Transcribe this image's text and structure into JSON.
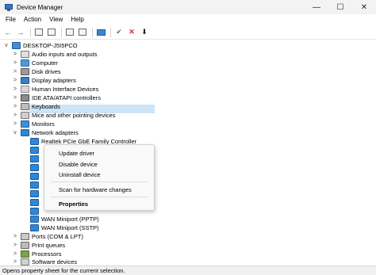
{
  "window": {
    "title": "Device Manager",
    "controls": {
      "minimize": "—",
      "maximize": "☐",
      "close": "✕"
    }
  },
  "menu": [
    "File",
    "Action",
    "View",
    "Help"
  ],
  "toolbar": {
    "back": "←",
    "forward": "→",
    "enable": "✔",
    "remove": "✕",
    "update": "⬇"
  },
  "tree": {
    "root": "DESKTOP-J5I5PCO",
    "categories": [
      "Audio inputs and outputs",
      "Computer",
      "Disk drives",
      "Display adapters",
      "Human Interface Devices",
      "IDE ATA/ATAPI controllers",
      "Keyboards",
      "Mice and other pointing devices",
      "Monitors",
      "Network adapters"
    ],
    "network_children": [
      "Realtek PCIe GbE Family Controller",
      "WAN Miniport (PPTP)",
      "WAN Miniport (SSTP)"
    ],
    "after_categories": [
      "Ports (COM & LPT)",
      "Print queues",
      "Processors",
      "Software devices"
    ],
    "expand_collapsed": ">",
    "expand_open": "v"
  },
  "context_menu": {
    "items": [
      "Update driver",
      "Disable device",
      "Uninstall device",
      "Scan for hardware changes",
      "Properties"
    ]
  },
  "status": "Opens property sheet for the current selection."
}
